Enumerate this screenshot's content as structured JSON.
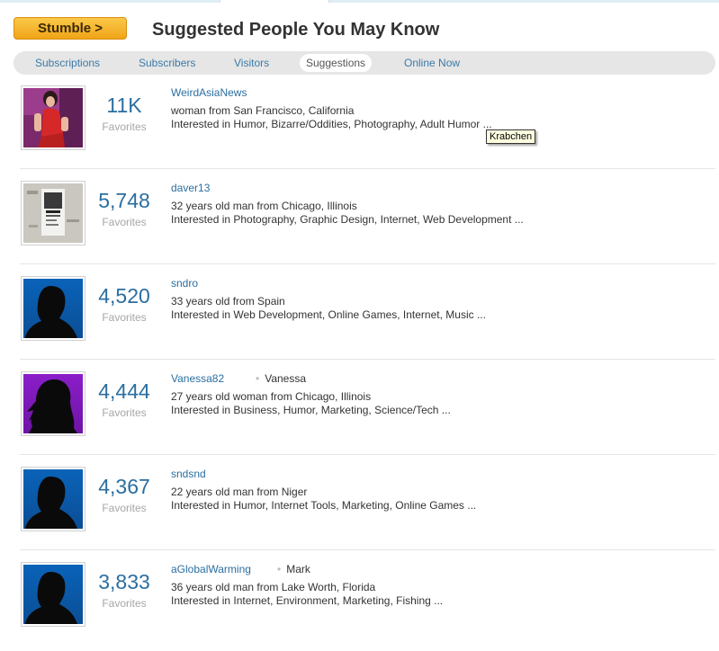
{
  "header": {
    "stumble_label": "Stumble >",
    "title": "Suggested People You May Know"
  },
  "tabs": [
    {
      "label": "Subscriptions",
      "active": false
    },
    {
      "label": "Subscribers",
      "active": false
    },
    {
      "label": "Visitors",
      "active": false
    },
    {
      "label": "Suggestions",
      "active": true
    },
    {
      "label": "Online Now",
      "active": false
    }
  ],
  "favorites_label": "Favorites",
  "people": [
    {
      "username": "WeirdAsiaNews",
      "real_name": "",
      "favorites": "11K",
      "line1": "woman from San Francisco, California",
      "line2": "Interested in Humor, Bizarre/Oddities, Photography, Adult Humor ...",
      "avatar": "photo-woman-red-dress"
    },
    {
      "username": "daver13",
      "real_name": "",
      "favorites": "5,748",
      "line1": "32 years old man from Chicago, Illinois",
      "line2": "Interested in Photography, Graphic Design, Internet, Web Development ...",
      "avatar": "photo-poster-wall"
    },
    {
      "username": "sndro",
      "real_name": "",
      "favorites": "4,520",
      "line1": "33 years old from Spain",
      "line2": "Interested in Web Development, Online Games, Internet, Music ...",
      "avatar": "silhouette-man-blue"
    },
    {
      "username": "Vanessa82",
      "real_name": "Vanessa",
      "favorites": "4,444",
      "line1": "27 years old woman from Chicago, Illinois",
      "line2": "Interested in Business, Humor, Marketing, Science/Tech ...",
      "avatar": "silhouette-woman-purple"
    },
    {
      "username": "sndsnd",
      "real_name": "",
      "favorites": "4,367",
      "line1": "22 years old man from Niger",
      "line2": "Interested in Humor, Internet Tools, Marketing, Online Games ...",
      "avatar": "silhouette-man-blue"
    },
    {
      "username": "aGlobalWarming",
      "real_name": "Mark",
      "favorites": "3,833",
      "line1": "36 years old man from Lake Worth, Florida",
      "line2": "Interested in Internet, Environment, Marketing, Fishing ...",
      "avatar": "silhouette-man-blue"
    }
  ],
  "tooltip": {
    "text": "Krabchen"
  },
  "colors": {
    "link": "#2a6ea0",
    "stumble_button": "#f5b22a",
    "tab_bar": "#e6e6e6",
    "favorites_label": "#a6a6a6"
  }
}
